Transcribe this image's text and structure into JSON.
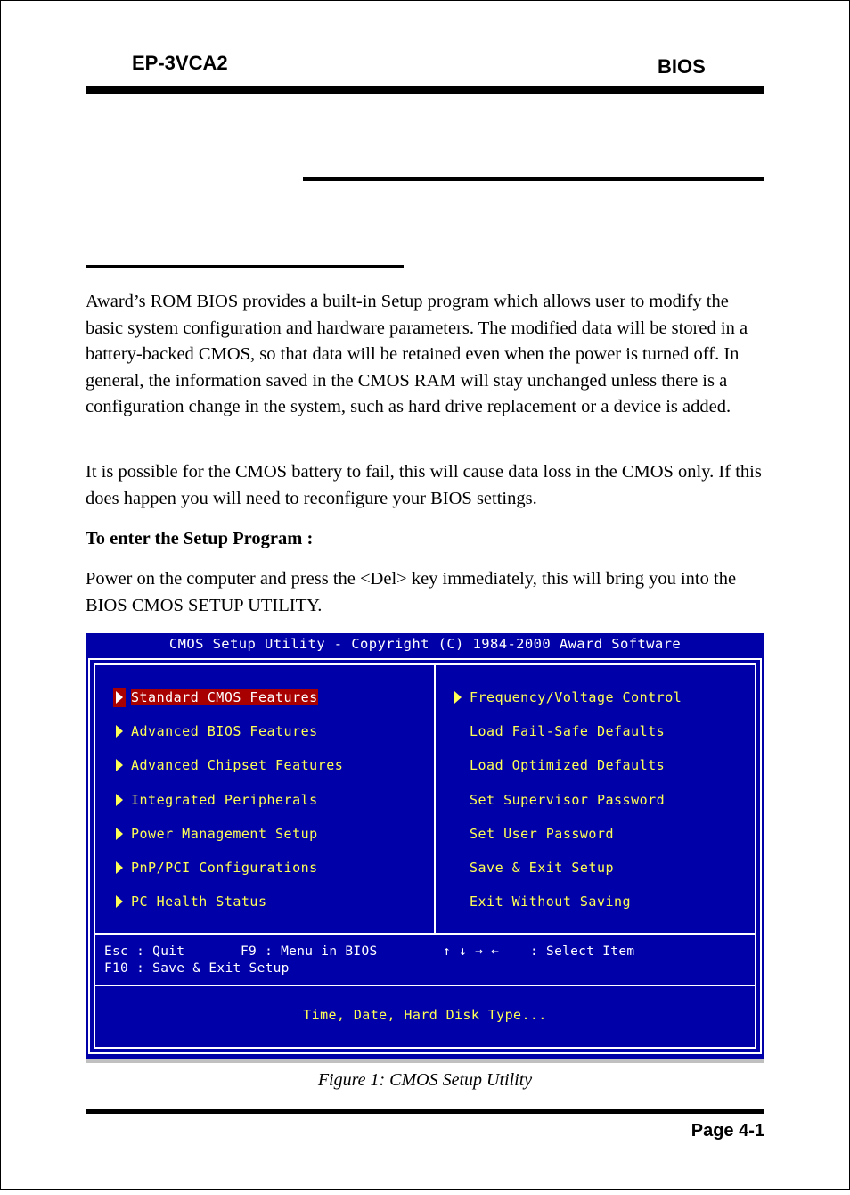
{
  "header": {
    "model": "EP-3VCA2",
    "section": "BIOS"
  },
  "body": {
    "paragraph1": "Award’s ROM BIOS provides a built-in Setup program which allows user to modify the basic system configuration and hardware parameters. The modified data will be stored in a battery-backed CMOS, so that data will be retained even when the power is turned off. In general, the information saved in the CMOS RAM will stay unchanged unless there is a configuration change in the system, such as hard drive replacement or a device is added.",
    "paragraph2": "It is possible for the CMOS battery to fail, this will cause data loss in the CMOS only. If this does happen you will need to reconfigure your BIOS settings.",
    "subheading": "To enter the Setup Program :",
    "paragraph3": "Power on the computer and press the <Del> key immediately, this will bring you into the BIOS CMOS SETUP UTILITY."
  },
  "bios": {
    "title": "CMOS Setup Utility - Copyright (C) 1984-2000 Award Software",
    "colors": {
      "background": "#0000a8",
      "text": "#ffff55",
      "highlight": "#a80000",
      "border": "#ffffff"
    },
    "left_menu": [
      {
        "label": "Standard CMOS Features",
        "submenu": true,
        "selected": true
      },
      {
        "label": "Advanced BIOS Features",
        "submenu": true
      },
      {
        "label": "Advanced Chipset Features",
        "submenu": true
      },
      {
        "label": "Integrated Peripherals",
        "submenu": true
      },
      {
        "label": "Power Management Setup",
        "submenu": true
      },
      {
        "label": "PnP/PCI Configurations",
        "submenu": true
      },
      {
        "label": "PC Health Status",
        "submenu": true
      }
    ],
    "right_menu": [
      {
        "label": "Frequency/Voltage Control",
        "submenu": true
      },
      {
        "label": "Load Fail-Safe Defaults",
        "submenu": false
      },
      {
        "label": "Load Optimized Defaults",
        "submenu": false
      },
      {
        "label": "Set Supervisor Password",
        "submenu": false
      },
      {
        "label": "Set User Password",
        "submenu": false
      },
      {
        "label": "Save & Exit Setup",
        "submenu": false
      },
      {
        "label": "Exit Without Saving",
        "submenu": false
      }
    ],
    "help": {
      "esc": "Esc : Quit",
      "f9": "F9 : Menu in BIOS",
      "arrows": "↑ ↓ → ←",
      "select": ": Select Item",
      "f10": "F10 : Save & Exit Setup"
    },
    "status": "Time, Date, Hard Disk Type..."
  },
  "caption": "Figure 1:  CMOS Setup Utility",
  "footer": {
    "page": "Page 4-1"
  }
}
